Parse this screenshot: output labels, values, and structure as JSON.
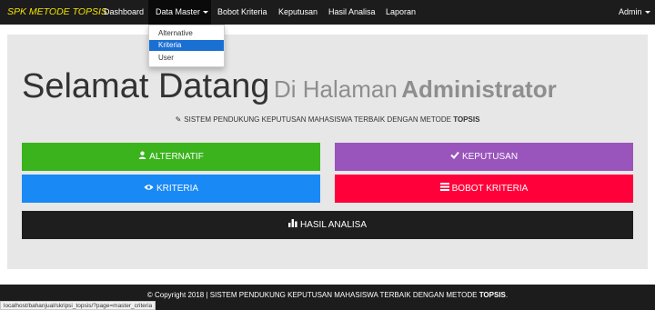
{
  "nav": {
    "brand": "SPK METODE TOPSIS",
    "items": [
      "Dashboard",
      "Data Master",
      "Bobot Kriteria",
      "Keputusan",
      "Hasil Analisa",
      "Laporan"
    ],
    "user": "Admin"
  },
  "dropdown": {
    "items": [
      "Alternative",
      "Kriteria",
      "User"
    ],
    "selected": "Kriteria"
  },
  "hero": {
    "title": "Selamat Datang",
    "sub": "Di Halaman",
    "strong": "Administrator"
  },
  "subtitle": {
    "text": "SISTEM PENDUKUNG KEPUTUSAN MAHASISWA TERBAIK DENGAN METODE",
    "strong": "TOPSIS",
    "icon": "pencil-icon"
  },
  "buttons": {
    "alternatif": {
      "label": "ALTERNATIF",
      "icon": "user-icon",
      "color": "#3bb31d"
    },
    "keputusan": {
      "label": "KEPUTUSAN",
      "icon": "check-icon",
      "color": "#9955bb"
    },
    "kriteria": {
      "label": "KRITERIA",
      "icon": "eye-icon",
      "color": "#1889f5"
    },
    "bobot": {
      "label": "BOBOT KRITERIA",
      "icon": "list-icon",
      "color": "#ff003a"
    },
    "hasil": {
      "label": "HASIL ANALISA",
      "icon": "bar-chart-icon",
      "color": "#1e1e1e"
    }
  },
  "footer": {
    "text": "© Copyright 2018 | SISTEM PENDUKUNG KEPUTUSAN MAHASISWA TERBAIK DENGAN METODE",
    "strong": "TOPSIS",
    "period": "."
  },
  "status_url": "localhost/bahanjual/skripsi_topsis/?page=master_criteria"
}
